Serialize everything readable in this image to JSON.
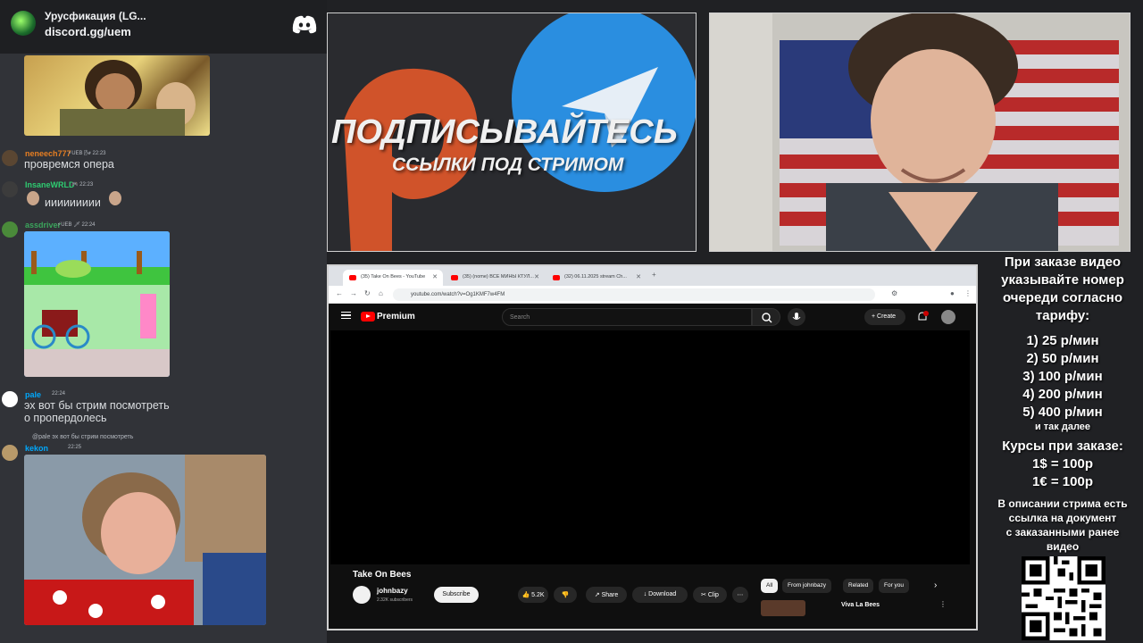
{
  "discord": {
    "server_name": "Урусфикация (LG...",
    "server_invite": "discord.gg/uem",
    "messages": [
      {
        "user": "neneech777",
        "badges": "⚡UEB 🌬 22:23",
        "text": "провремся опера",
        "user_color": "#e67e22"
      },
      {
        "user": "InsaneWRLD",
        "badges": "🎮 22:23",
        "text": "иииииииии",
        "user_color": "#2ecc71"
      },
      {
        "user": "assdriver",
        "badges": "⚡UEB 🗡 22:24",
        "text": "",
        "user_color": "#3ba55c"
      },
      {
        "user": "pale",
        "badges": "22:24",
        "text_line1": "эх вот бы стрим посмотреть",
        "text_line2": "о пропердолесь",
        "user_color": "#00a8fc"
      },
      {
        "user": "kekon",
        "badges": "22:25",
        "reply": "@pale эх вот бы стрим посмотреть",
        "text": "",
        "user_color": "#00a8fc"
      }
    ]
  },
  "promo": {
    "headline": "ПОДПИСЫВАЙТЕСЬ",
    "subline": "ССЫЛКИ ПОД СТРИМОМ"
  },
  "browser": {
    "tabs": [
      {
        "title": "(35) Take On Bees - YouTube"
      },
      {
        "title": "(35) (nome) ВСЕ МИНЫ КТУЛ..."
      },
      {
        "title": "(32) 06.11.2025 stream Ch..."
      }
    ],
    "url": "youtube.com/watch?v=Og1KMF7w4FM",
    "youtube": {
      "brand": "Premium",
      "search_placeholder": "Search",
      "create_label": "Create",
      "notif_count": "9+",
      "video_title": "Take On Bees",
      "channel_name": "johnbazy",
      "channel_subs": "2.32K subscribers",
      "subscribe_label": "Subscribe",
      "likes": "5.2K",
      "share_label": "Share",
      "download_label": "Download",
      "clip_label": "Clip",
      "chips": [
        "All",
        "From johnbazy",
        "Related",
        "For you"
      ],
      "rec_title": "Viva La Bees"
    }
  },
  "info_panel": {
    "intro_1": "При заказе видео",
    "intro_2": "указывайте номер",
    "intro_3": "очереди согласно",
    "intro_4": "тарифу:",
    "rates": [
      "1) 25 р/мин",
      "2) 50 р/мин",
      "3) 100 р/мин",
      "4) 200 р/мин",
      "5) 400 р/мин"
    ],
    "etc": "и так далее",
    "courses_title": "Курсы при заказе:",
    "course_usd": "1$ = 100р",
    "course_eur": "1€ = 100р",
    "desc_1": "В описании стрима есть",
    "desc_2": "ссылка на документ",
    "desc_3": "с заказанными ранее",
    "desc_4": "видео"
  }
}
